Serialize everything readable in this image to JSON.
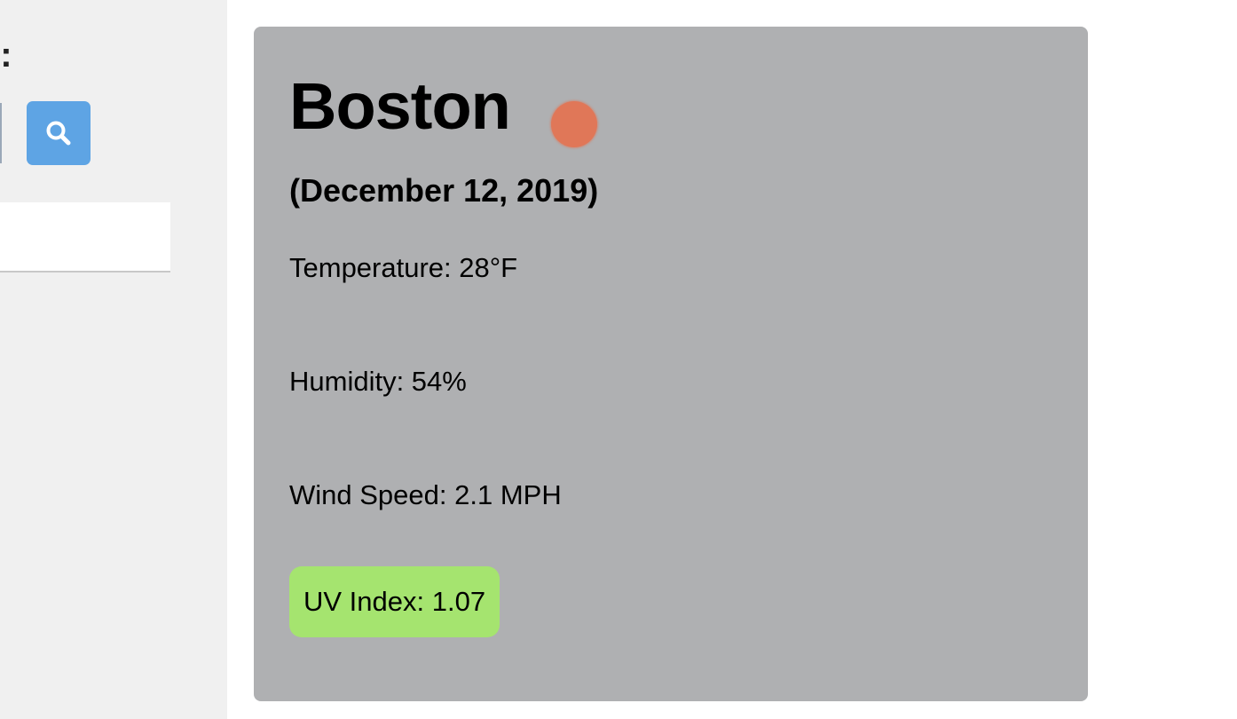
{
  "sidebar": {
    "heading": "y:",
    "search_button_icon": "search-icon",
    "colors": {
      "background": "#f0f0f0",
      "button": "#5ea4e4"
    }
  },
  "weather": {
    "city": "Boston",
    "icon": "weather-condition-icon",
    "date": "(December 12, 2019)",
    "temperature": "Temperature: 28°F",
    "humidity": "Humidity: 54%",
    "wind_speed": "Wind Speed: 2.1 MPH",
    "uv_index": "UV Index: 1.07",
    "colors": {
      "card": "#afb0b2",
      "icon": "#e07758",
      "uv_badge": "#a5e46f"
    }
  }
}
